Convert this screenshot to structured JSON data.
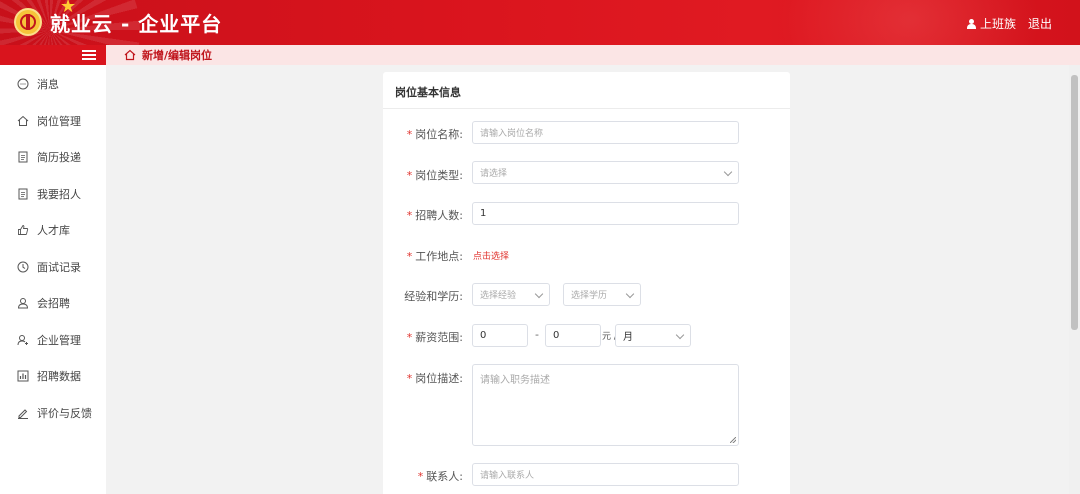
{
  "header": {
    "app_title": "就业云 - 企业平台",
    "user_name": "上班族",
    "logout_label": "退出"
  },
  "sidebar": {
    "items": [
      {
        "label": "消息",
        "icon": "message-icon"
      },
      {
        "label": "岗位管理",
        "icon": "home-icon"
      },
      {
        "label": "简历投递",
        "icon": "document-icon"
      },
      {
        "label": "我要招人",
        "icon": "document-icon"
      },
      {
        "label": "人才库",
        "icon": "thumbs-up-icon"
      },
      {
        "label": "面试记录",
        "icon": "clock-icon"
      },
      {
        "label": "会招聘",
        "icon": "users-icon"
      },
      {
        "label": "企业管理",
        "icon": "user-manage-icon"
      },
      {
        "label": "招聘数据",
        "icon": "chart-icon"
      },
      {
        "label": "评价与反馈",
        "icon": "edit-icon"
      }
    ]
  },
  "breadcrumb": {
    "current": "新增/编辑岗位"
  },
  "form": {
    "section_title": "岗位基本信息",
    "job_name": {
      "label": "岗位名称:",
      "placeholder": "请输入岗位名称"
    },
    "job_type": {
      "label": "岗位类型:",
      "placeholder": "请选择"
    },
    "headcount": {
      "label": "招聘人数:",
      "value": "1"
    },
    "location": {
      "label": "工作地点:",
      "link": "点击选择"
    },
    "exp_edu": {
      "label": "经验和学历:",
      "experience_placeholder": "选择经验",
      "education_placeholder": "选择学历"
    },
    "salary": {
      "label": "薪资范围:",
      "min": "0",
      "separator": "-",
      "max": "0",
      "unit": "元 /",
      "period": "月"
    },
    "description": {
      "label": "岗位描述:",
      "placeholder": "请输入职务描述"
    },
    "contact": {
      "label": "联系人:",
      "placeholder": "请输入联系人"
    }
  },
  "colors": {
    "brand_red": "#d9141d",
    "required_star": "#e0332e",
    "breadcrumb_bg": "#fbe5e5"
  }
}
